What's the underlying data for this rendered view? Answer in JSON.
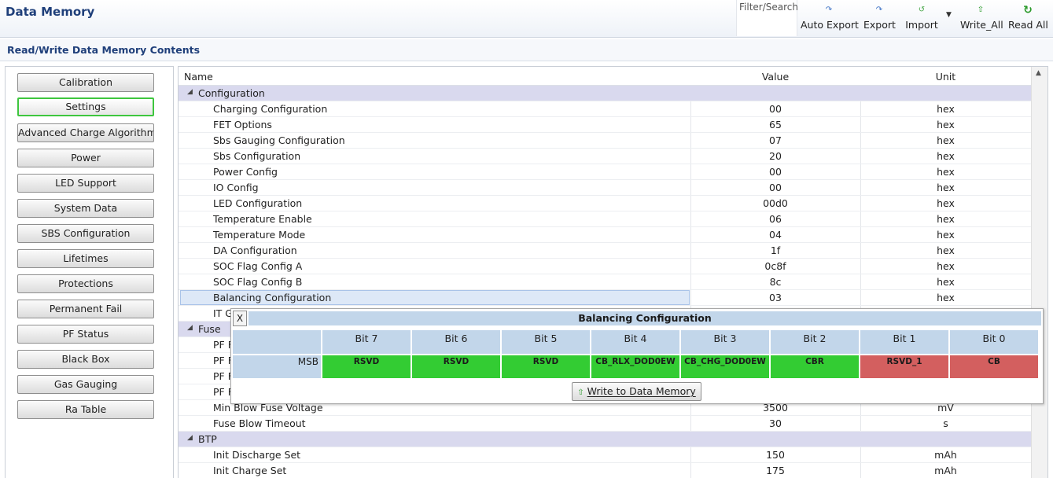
{
  "header": {
    "title": "Data Memory",
    "filter_label": "Filter/Search",
    "toolbar": [
      {
        "label": "Auto Export",
        "icon": "auto-export-icon"
      },
      {
        "label": "Export",
        "icon": "export-icon"
      },
      {
        "label": "Import",
        "icon": "import-icon"
      },
      {
        "label": "Write_All",
        "icon": "write-all-icon"
      },
      {
        "label": "Read All",
        "icon": "refresh-icon"
      }
    ]
  },
  "section": {
    "title": "Read/Write Data Memory Contents"
  },
  "nav": {
    "selected": "Settings",
    "items": [
      "Calibration",
      "Settings",
      "Advanced Charge Algorithm",
      "Power",
      "LED Support",
      "System Data",
      "SBS Configuration",
      "Lifetimes",
      "Protections",
      "Permanent Fail",
      "PF Status",
      "Black Box",
      "Gas Gauging",
      "Ra Table"
    ]
  },
  "table": {
    "columns": [
      "Name",
      "Value",
      "Unit"
    ],
    "rows": [
      {
        "type": "group",
        "name": "Configuration"
      },
      {
        "type": "item",
        "name": "Charging Configuration",
        "value": "00",
        "unit": "hex"
      },
      {
        "type": "item",
        "name": "FET Options",
        "value": "65",
        "unit": "hex"
      },
      {
        "type": "item",
        "name": "Sbs Gauging Configuration",
        "value": "07",
        "unit": "hex"
      },
      {
        "type": "item",
        "name": "Sbs Configuration",
        "value": "20",
        "unit": "hex"
      },
      {
        "type": "item",
        "name": "Power Config",
        "value": "00",
        "unit": "hex"
      },
      {
        "type": "item",
        "name": "IO Config",
        "value": "00",
        "unit": "hex"
      },
      {
        "type": "item",
        "name": "LED Configuration",
        "value": "00d0",
        "unit": "hex"
      },
      {
        "type": "item",
        "name": "Temperature Enable",
        "value": "06",
        "unit": "hex"
      },
      {
        "type": "item",
        "name": "Temperature Mode",
        "value": "04",
        "unit": "hex"
      },
      {
        "type": "item",
        "name": "DA Configuration",
        "value": "1f",
        "unit": "hex"
      },
      {
        "type": "item",
        "name": "SOC Flag Config A",
        "value": "0c8f",
        "unit": "hex"
      },
      {
        "type": "item",
        "name": "SOC Flag Config B",
        "value": "8c",
        "unit": "hex"
      },
      {
        "type": "item",
        "name": "Balancing Configuration",
        "value": "03",
        "unit": "hex",
        "selected": true
      },
      {
        "type": "item",
        "name": "IT G",
        "value": "",
        "unit": ""
      },
      {
        "type": "group",
        "name": "Fuse"
      },
      {
        "type": "item",
        "name": "PF F",
        "value": "",
        "unit": ""
      },
      {
        "type": "item",
        "name": "PF F",
        "value": "",
        "unit": ""
      },
      {
        "type": "item",
        "name": "PF F",
        "value": "",
        "unit": ""
      },
      {
        "type": "item",
        "name": "PF F",
        "value": "",
        "unit": ""
      },
      {
        "type": "item",
        "name": "Min Blow Fuse Voltage",
        "value": "3500",
        "unit": "mV"
      },
      {
        "type": "item",
        "name": "Fuse Blow Timeout",
        "value": "30",
        "unit": "s"
      },
      {
        "type": "group",
        "name": "BTP"
      },
      {
        "type": "item",
        "name": "Init Discharge Set",
        "value": "150",
        "unit": "mAh"
      },
      {
        "type": "item",
        "name": "Init Charge Set",
        "value": "175",
        "unit": "mAh"
      }
    ]
  },
  "popup": {
    "close_label": "X",
    "title": "Balancing Configuration",
    "row_label": "MSB",
    "bit_headers": [
      "Bit 7",
      "Bit 6",
      "Bit 5",
      "Bit 4",
      "Bit 3",
      "Bit 2",
      "Bit 1",
      "Bit 0"
    ],
    "bits": [
      {
        "name": "RSVD",
        "state": "on"
      },
      {
        "name": "RSVD",
        "state": "on"
      },
      {
        "name": "RSVD",
        "state": "on"
      },
      {
        "name": "CB_RLX_DOD0EW",
        "state": "on"
      },
      {
        "name": "CB_CHG_DOD0EW",
        "state": "on"
      },
      {
        "name": "CBR",
        "state": "on"
      },
      {
        "name": "RSVD_1",
        "state": "off"
      },
      {
        "name": "CB",
        "state": "off"
      }
    ],
    "write_button": "Write to Data Memory",
    "colors": {
      "on": "#33cc33",
      "off": "#d35f5f",
      "header": "#c2d6ea"
    }
  }
}
